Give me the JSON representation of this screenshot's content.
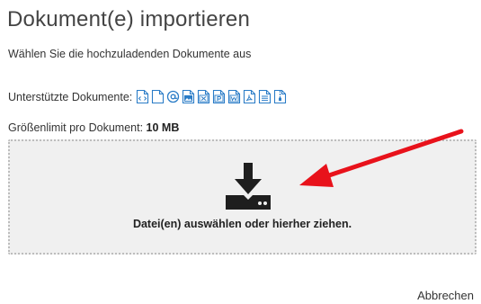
{
  "dialog": {
    "title": "Dokument(e) importieren",
    "subtitle": "Wählen Sie die hochzuladenden Dokumente aus",
    "supported_label": "Unterstützte Dokumente:",
    "supported_icons": [
      "code-file-icon",
      "blank-file-icon",
      "email-at-icon",
      "image-file-icon",
      "excel-file-icon",
      "powerpoint-file-icon",
      "word-file-icon",
      "pdf-file-icon",
      "text-file-icon",
      "archive-file-icon"
    ],
    "limit_label": "Größenlimit pro Dokument:",
    "limit_value": "10 MB",
    "dropzone_text": "Datei(en) auswählen oder hierher ziehen.",
    "cancel_label": "Abbrechen"
  },
  "colors": {
    "icon_blue": "#2a7cc7",
    "arrow_red": "#e8121b",
    "dropzone_bg": "#f0f0f0"
  }
}
